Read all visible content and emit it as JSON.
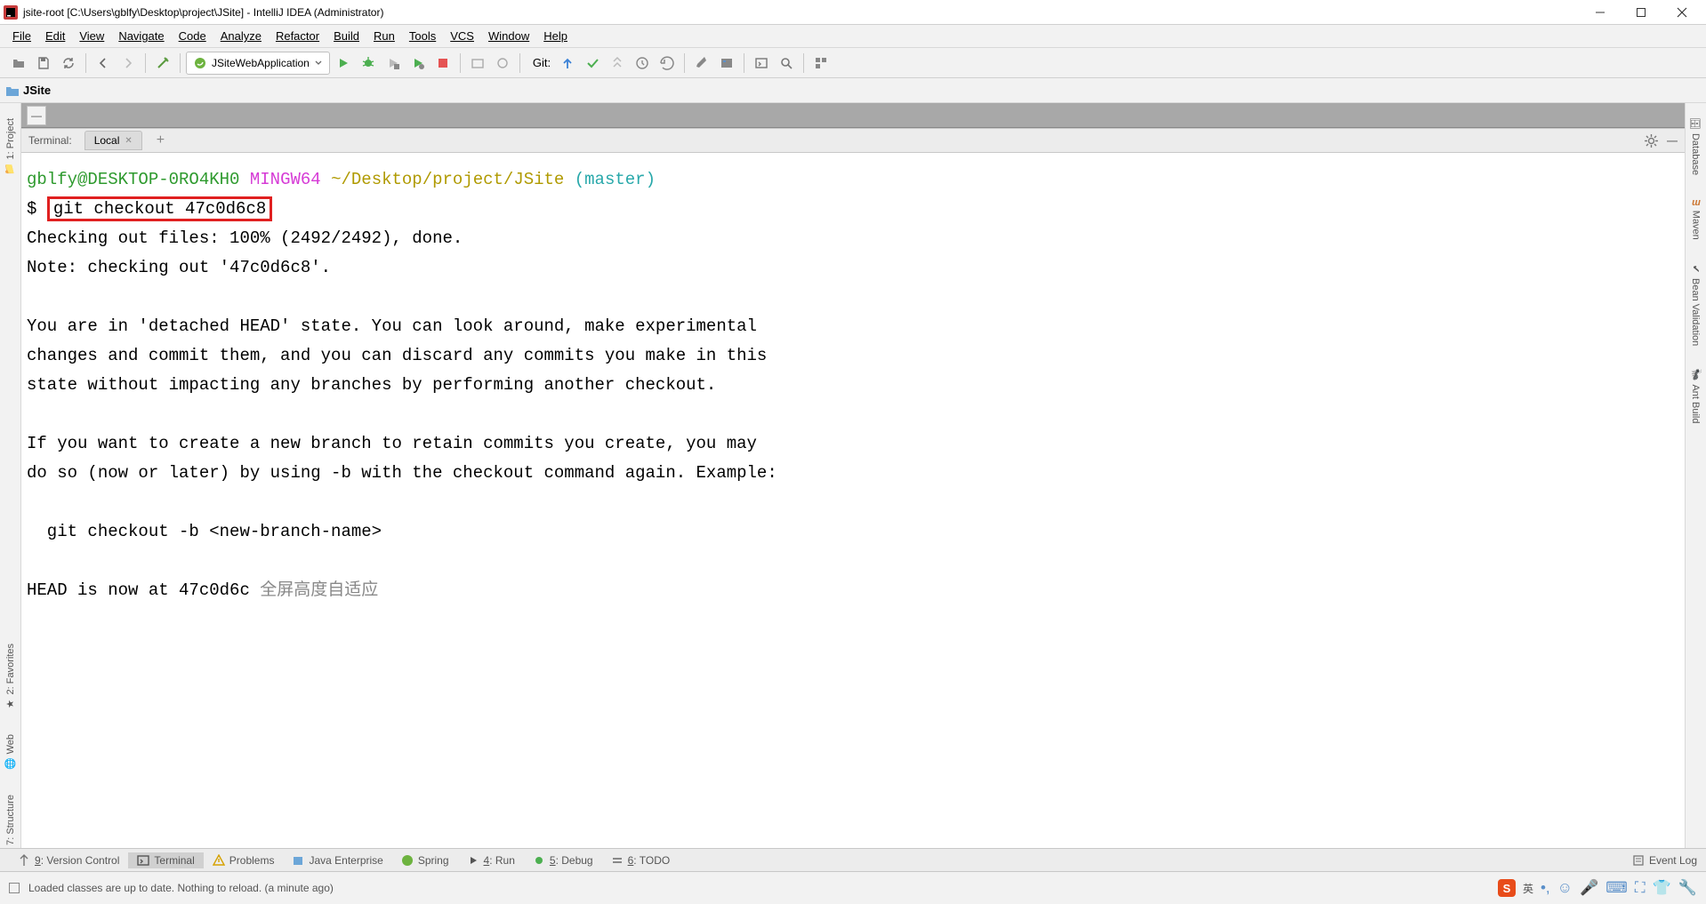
{
  "window": {
    "title": "jsite-root [C:\\Users\\gblfy\\Desktop\\project\\JSite] - IntelliJ IDEA (Administrator)"
  },
  "menu": [
    "File",
    "Edit",
    "View",
    "Navigate",
    "Code",
    "Analyze",
    "Refactor",
    "Build",
    "Run",
    "Tools",
    "VCS",
    "Window",
    "Help"
  ],
  "toolbar": {
    "run_config": "JSiteWebApplication",
    "git_label": "Git:"
  },
  "breadcrumb": {
    "root": "JSite"
  },
  "left_tabs": [
    "1: Project",
    "2: Favorites",
    "Web",
    "7: Structure"
  ],
  "right_tabs": [
    "Database",
    "Maven",
    "Bean Validation",
    "Ant Build"
  ],
  "terminal": {
    "label": "Terminal:",
    "tab": "Local",
    "prompt_user": "gblfy@DESKTOP-0RO4KH0",
    "prompt_shell": "MINGW64",
    "prompt_path": "~/Desktop/project/JSite",
    "prompt_branch": "(master)",
    "prompt_sym": "$",
    "cmd": "git checkout 47c0d6c8",
    "out1": "Checking out files: 100% (2492/2492), done.",
    "out2": "Note: checking out '47c0d6c8'.",
    "out3": "You are in 'detached HEAD' state. You can look around, make experimental",
    "out4": "changes and commit them, and you can discard any commits you make in this",
    "out5": "state without impacting any branches by performing another checkout.",
    "out6": "If you want to create a new branch to retain commits you create, you may",
    "out7": "do so (now or later) by using -b with the checkout command again. Example:",
    "out8": "  git checkout -b <new-branch-name>",
    "out9a": "HEAD is now at 47c0d6c ",
    "out9b": "全屏高度自适应"
  },
  "bottom_tabs": {
    "vcs": "9: Version Control",
    "terminal": "Terminal",
    "problems": "Problems",
    "javaee": "Java Enterprise",
    "spring": "Spring",
    "run": "4: Run",
    "debug": "5: Debug",
    "todo": "6: TODO",
    "eventlog": "Event Log"
  },
  "status": {
    "msg": "Loaded classes are up to date. Nothing to reload. (a minute ago)",
    "ime": "英"
  }
}
